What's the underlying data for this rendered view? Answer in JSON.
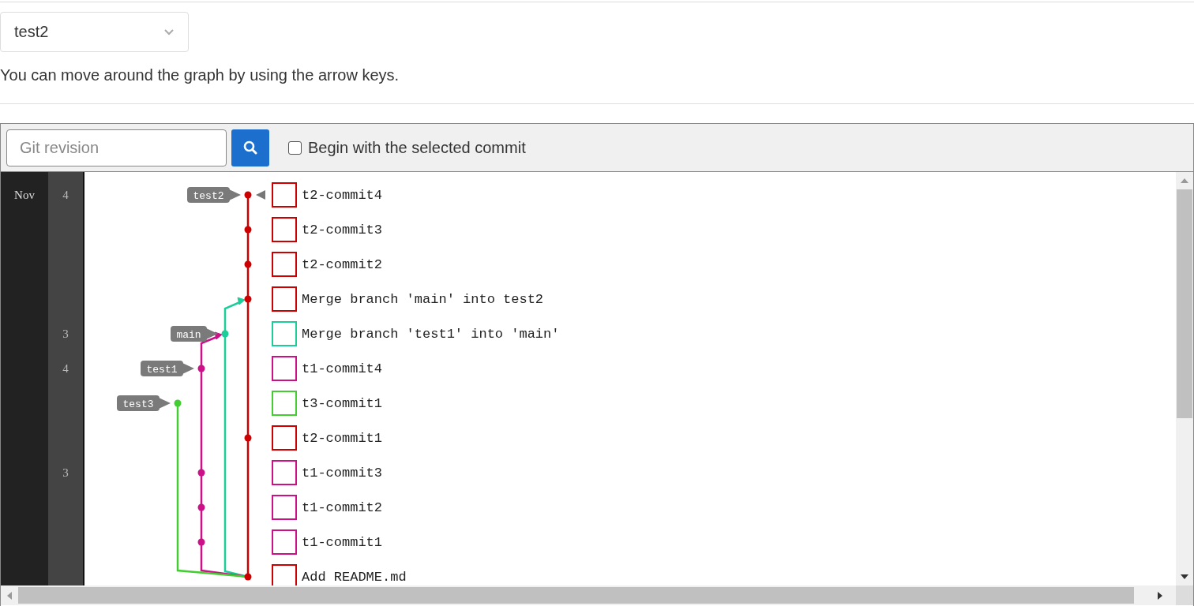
{
  "branch_select": {
    "value": "test2"
  },
  "hint": "You can move around the graph by using the arrow keys.",
  "toolbar": {
    "revision_field": {
      "placeholder": "Git revision"
    },
    "begin_with_selected": {
      "label": "Begin with the selected commit",
      "checked": false
    }
  },
  "commits": [
    {
      "message": "t2-commit4",
      "color": "#cc0000",
      "month": "Nov",
      "day": "4",
      "tag": "test2",
      "current": true
    },
    {
      "message": "t2-commit3",
      "color": "#cc0000",
      "current": false
    },
    {
      "message": "t2-commit2",
      "color": "#cc0000",
      "current": false
    },
    {
      "message": "Merge branch 'main' into test2",
      "color": "#cc0000",
      "current": false
    },
    {
      "message": "Merge branch 'test1' into 'main'",
      "color": "#1ccc99",
      "day": "3",
      "tag": "main",
      "current": false
    },
    {
      "message": "t1-commit4",
      "color": "#cc1188",
      "day": "4",
      "tag": "test1",
      "current": false
    },
    {
      "message": "t3-commit1",
      "color": "#44cc33",
      "tag": "test3",
      "current": false
    },
    {
      "message": "t2-commit1",
      "color": "#cc0000",
      "current": false
    },
    {
      "message": "t1-commit3",
      "color": "#cc1188",
      "day": "3",
      "current": false
    },
    {
      "message": "t1-commit2",
      "color": "#cc1188",
      "current": false
    },
    {
      "message": "t1-commit1",
      "color": "#cc1188",
      "current": false
    },
    {
      "message": "Add README.md",
      "color": "#cc0000",
      "current": false
    }
  ]
}
